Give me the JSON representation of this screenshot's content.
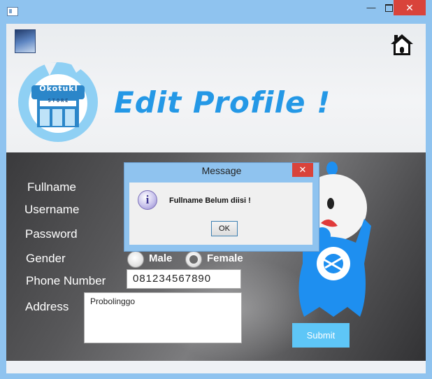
{
  "window": {
    "minimize_glyph": "—",
    "close_glyph": "✕",
    "app_icon": "window-app-icon"
  },
  "header": {
    "title": "Edit Profile !",
    "logo": {
      "brand": "OkotukI",
      "sub": "STORE"
    },
    "home_icon": "home-icon",
    "thumbnail_icon": "image-thumbnail"
  },
  "form": {
    "labels": {
      "fullname": "Fullname",
      "username": "Username",
      "password": "Password",
      "gender": "Gender",
      "phone": "Phone Number",
      "address": "Address"
    },
    "gender_options": [
      {
        "label": "Male",
        "checked": false
      },
      {
        "label": "Female",
        "checked": true
      }
    ],
    "phone_value": "081234567890",
    "address_value": "Probolinggo",
    "submit_label": "Submit"
  },
  "dialog": {
    "title": "Message",
    "message": "Fullname Belum diisi !",
    "ok_label": "OK",
    "close_glyph": "✕",
    "icon": "info-icon"
  },
  "colors": {
    "title_blue": "#2498e6",
    "submit_blue": "#5ec6f7",
    "close_red": "#d9433b",
    "chrome_blue": "#8fc3ef"
  }
}
